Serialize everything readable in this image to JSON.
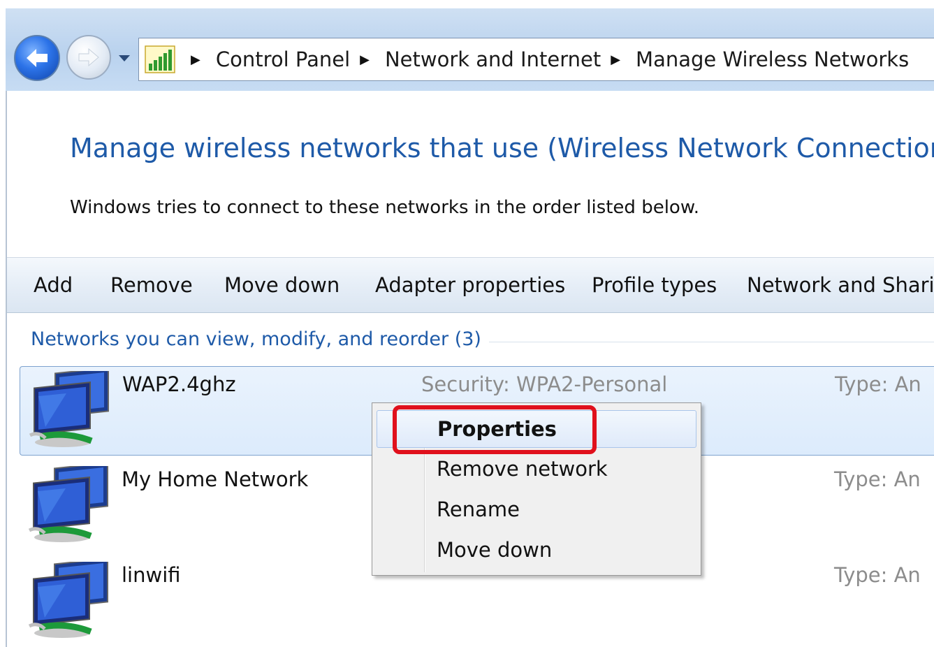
{
  "breadcrumb": {
    "items": [
      "Control Panel",
      "Network and Internet",
      "Manage Wireless Networks"
    ]
  },
  "heading": {
    "title": "Manage wireless networks that use (Wireless Network Connection)",
    "subtitle": "Windows tries to connect to these networks in the order listed below."
  },
  "toolbar": {
    "add": "Add",
    "remove": "Remove",
    "move_down": "Move down",
    "adapter_properties": "Adapter properties",
    "profile_types": "Profile types",
    "network_sharing": "Network and Shari"
  },
  "group": {
    "header": "Networks you can view, modify, and reorder (3)"
  },
  "networks": [
    {
      "name": "WAP2.4ghz",
      "security": "Security:  WPA2-Personal",
      "type": "Type:  An"
    },
    {
      "name": "My Home Network",
      "type": "Type:  An"
    },
    {
      "name": "linwifi",
      "type": "Type:  An"
    }
  ],
  "context_menu": {
    "items": [
      "Properties",
      "Remove network",
      "Rename",
      "Move down"
    ]
  },
  "colors": {
    "link_blue": "#1e5aa8",
    "highlight_red": "#e0101c",
    "selection_border": "#7da2ce"
  }
}
